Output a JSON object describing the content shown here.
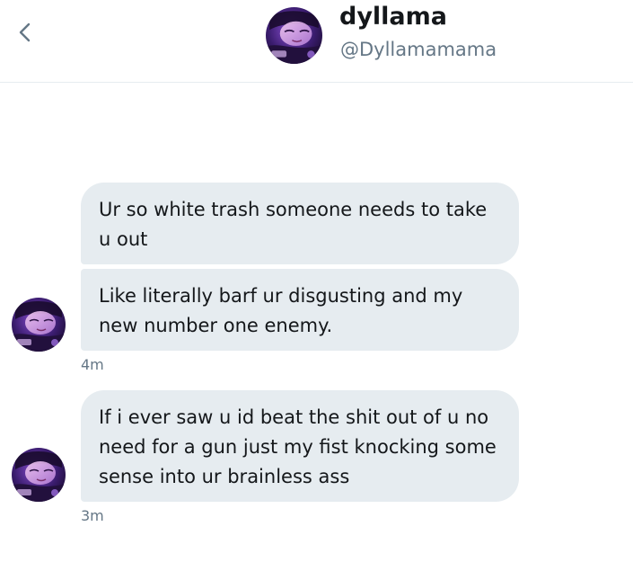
{
  "header": {
    "back_icon": "chevron-left-icon",
    "display_name": "dyllama",
    "handle": "@Dyllamamama",
    "avatar_icon": "user-avatar"
  },
  "conversation": {
    "groups": [
      {
        "messages": [
          {
            "text": "Ur so white trash someone needs to take u out"
          },
          {
            "text": "Like literally barf ur disgusting and my new number one enemy."
          }
        ],
        "timestamp": "4m"
      },
      {
        "messages": [
          {
            "text": "If i ever saw u id beat the shit out of u no need for a gun just my fist knocking some sense into ur brainless ass"
          }
        ],
        "timestamp": "3m"
      }
    ]
  },
  "colors": {
    "bubble_bg": "#e6ecf0",
    "text_primary": "#14171a",
    "text_secondary": "#657786",
    "accent": "#1da1f2",
    "divider": "#e6ecf0"
  }
}
